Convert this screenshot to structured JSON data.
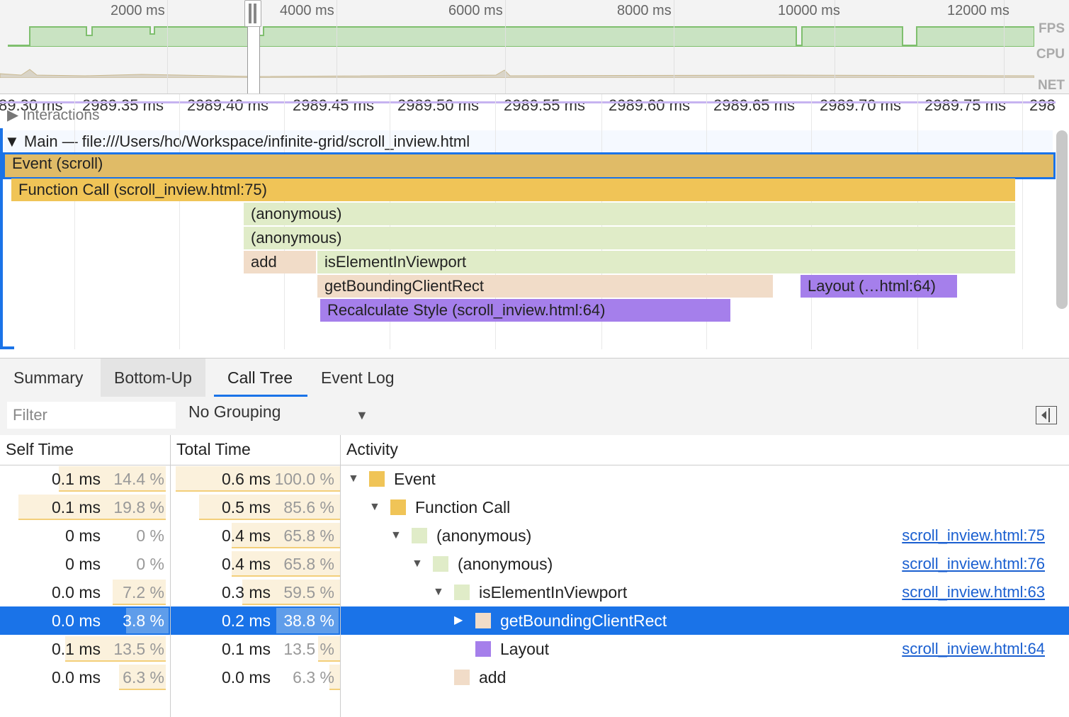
{
  "overview": {
    "ticks": [
      "2000 ms",
      "4000 ms",
      "6000 ms",
      "8000 ms",
      "10000 ms",
      "12000 ms"
    ],
    "labels": {
      "fps": "FPS",
      "cpu": "CPU",
      "net": "NET"
    }
  },
  "ruler": {
    "ticks": [
      "89.30 ms",
      "2989.35 ms",
      "2989.40 ms",
      "2989.45 ms",
      "2989.50 ms",
      "2989.55 ms",
      "2989.60 ms",
      "2989.65 ms",
      "2989.70 ms",
      "2989.75 ms",
      "298"
    ]
  },
  "flame": {
    "interactions_label": "Interactions",
    "main_label": "Main — file:///Users/ho/Workspace/infinite-grid/scroll_inview.html",
    "bars": [
      {
        "label": "Event (scroll)",
        "color": "#e0bb67"
      },
      {
        "label": "Function Call (scroll_inview.html:75)",
        "color": "#f0c457"
      },
      {
        "label": "(anonymous)",
        "color": "#e0ecc8"
      },
      {
        "label": "(anonymous)",
        "color": "#e0ecc8"
      },
      {
        "label": "add",
        "color": "#f1dcc8"
      },
      {
        "label": "isElementInViewport",
        "color": "#e0ecc8"
      },
      {
        "label": "getBoundingClientRect",
        "color": "#f1dcc8"
      },
      {
        "label": "Layout (…html:64)",
        "color": "#a57feb"
      },
      {
        "label": "Recalculate Style (scroll_inview.html:64)",
        "color": "#a57feb"
      }
    ]
  },
  "tabs": [
    "Summary",
    "Bottom-Up",
    "Call Tree",
    "Event Log"
  ],
  "toolbar": {
    "filter_placeholder": "Filter",
    "grouping": "No Grouping"
  },
  "table": {
    "headers": {
      "self": "Self Time",
      "total": "Total Time",
      "activity": "Activity"
    },
    "rows": [
      {
        "self_ms": "0.1 ms",
        "self_pct": "14.4 %",
        "self_frac": 0.144,
        "total_ms": "0.6 ms",
        "total_pct": "100.0 %",
        "total_frac": 1.0,
        "name": "Event",
        "swatch": "#f0c457",
        "depth": 0,
        "expander": "▼",
        "link": ""
      },
      {
        "self_ms": "0.1 ms",
        "self_pct": "19.8 %",
        "self_frac": 0.198,
        "total_ms": "0.5 ms",
        "total_pct": "85.6 %",
        "total_frac": 0.856,
        "name": "Function Call",
        "swatch": "#f0c457",
        "depth": 1,
        "expander": "▼",
        "link": ""
      },
      {
        "self_ms": "0 ms",
        "self_pct": "0 %",
        "self_frac": 0,
        "total_ms": "0.4 ms",
        "total_pct": "65.8 %",
        "total_frac": 0.658,
        "name": "(anonymous)",
        "swatch": "#e0ecc8",
        "depth": 2,
        "expander": "▼",
        "link": "scroll_inview.html:75"
      },
      {
        "self_ms": "0 ms",
        "self_pct": "0 %",
        "self_frac": 0,
        "total_ms": "0.4 ms",
        "total_pct": "65.8 %",
        "total_frac": 0.658,
        "name": "(anonymous)",
        "swatch": "#e0ecc8",
        "depth": 3,
        "expander": "▼",
        "link": "scroll_inview.html:76"
      },
      {
        "self_ms": "0.0 ms",
        "self_pct": "7.2 %",
        "self_frac": 0.072,
        "total_ms": "0.3 ms",
        "total_pct": "59.5 %",
        "total_frac": 0.595,
        "name": "isElementInViewport",
        "swatch": "#e0ecc8",
        "depth": 4,
        "expander": "▼",
        "link": "scroll_inview.html:63"
      },
      {
        "self_ms": "0.0 ms",
        "self_pct": "3.8 %",
        "self_frac": 0.038,
        "total_ms": "0.2 ms",
        "total_pct": "38.8 %",
        "total_frac": 0.388,
        "name": "getBoundingClientRect",
        "swatch": "#f1dcc8",
        "depth": 5,
        "expander": "▶",
        "link": "",
        "selected": true
      },
      {
        "self_ms": "0.1 ms",
        "self_pct": "13.5 %",
        "self_frac": 0.135,
        "total_ms": "0.1 ms",
        "total_pct": "13.5 %",
        "total_frac": 0.135,
        "name": "Layout",
        "swatch": "#a57feb",
        "depth": 5,
        "expander": "",
        "link": "scroll_inview.html:64"
      },
      {
        "self_ms": "0.0 ms",
        "self_pct": "6.3 %",
        "self_frac": 0.063,
        "total_ms": "0.0 ms",
        "total_pct": "6.3 %",
        "total_frac": 0.063,
        "name": "add",
        "swatch": "#f1dcc8",
        "depth": 4,
        "expander": "",
        "link": ""
      }
    ]
  }
}
